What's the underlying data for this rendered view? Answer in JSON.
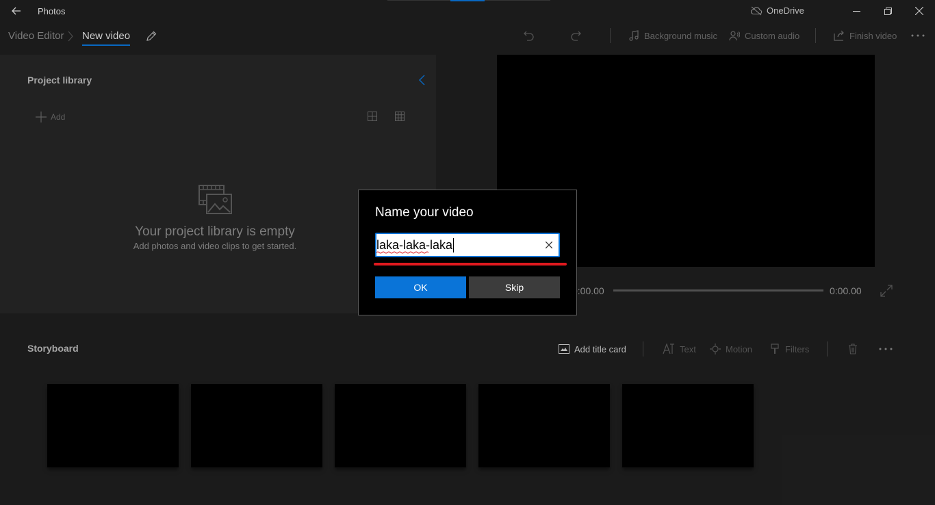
{
  "titlebar": {
    "app_title": "Photos",
    "onedrive_label": "OneDrive",
    "back_icon": "back-arrow-icon",
    "minimize_icon": "minimize-icon",
    "restore_icon": "restore-icon",
    "close_icon": "close-icon"
  },
  "breadcrumb": {
    "root": "Video Editor",
    "separator": ">",
    "current": "New video"
  },
  "commandbar": {
    "background_music": "Background music",
    "custom_audio": "Custom audio",
    "finish_video": "Finish video",
    "more": "..."
  },
  "library": {
    "title": "Project library",
    "add_label": "Add",
    "empty_title": "Your project library is empty",
    "empty_subtitle": "Add photos and video clips to get started."
  },
  "preview": {
    "time_start": "0:00.00",
    "time_end": "0:00.00"
  },
  "storyboard": {
    "title": "Storyboard",
    "add_title_card": "Add title card",
    "text": "Text",
    "motion": "Motion",
    "filters": "Filters",
    "clip_count": 5
  },
  "dialog": {
    "title": "Name your video",
    "input_value": "laka-laka-laka",
    "ok_label": "OK",
    "skip_label": "Skip"
  },
  "colors": {
    "accent": "#0a74d8",
    "annotation_red": "#e0191e",
    "background": "#1f1f1f",
    "panel": "#262626"
  }
}
